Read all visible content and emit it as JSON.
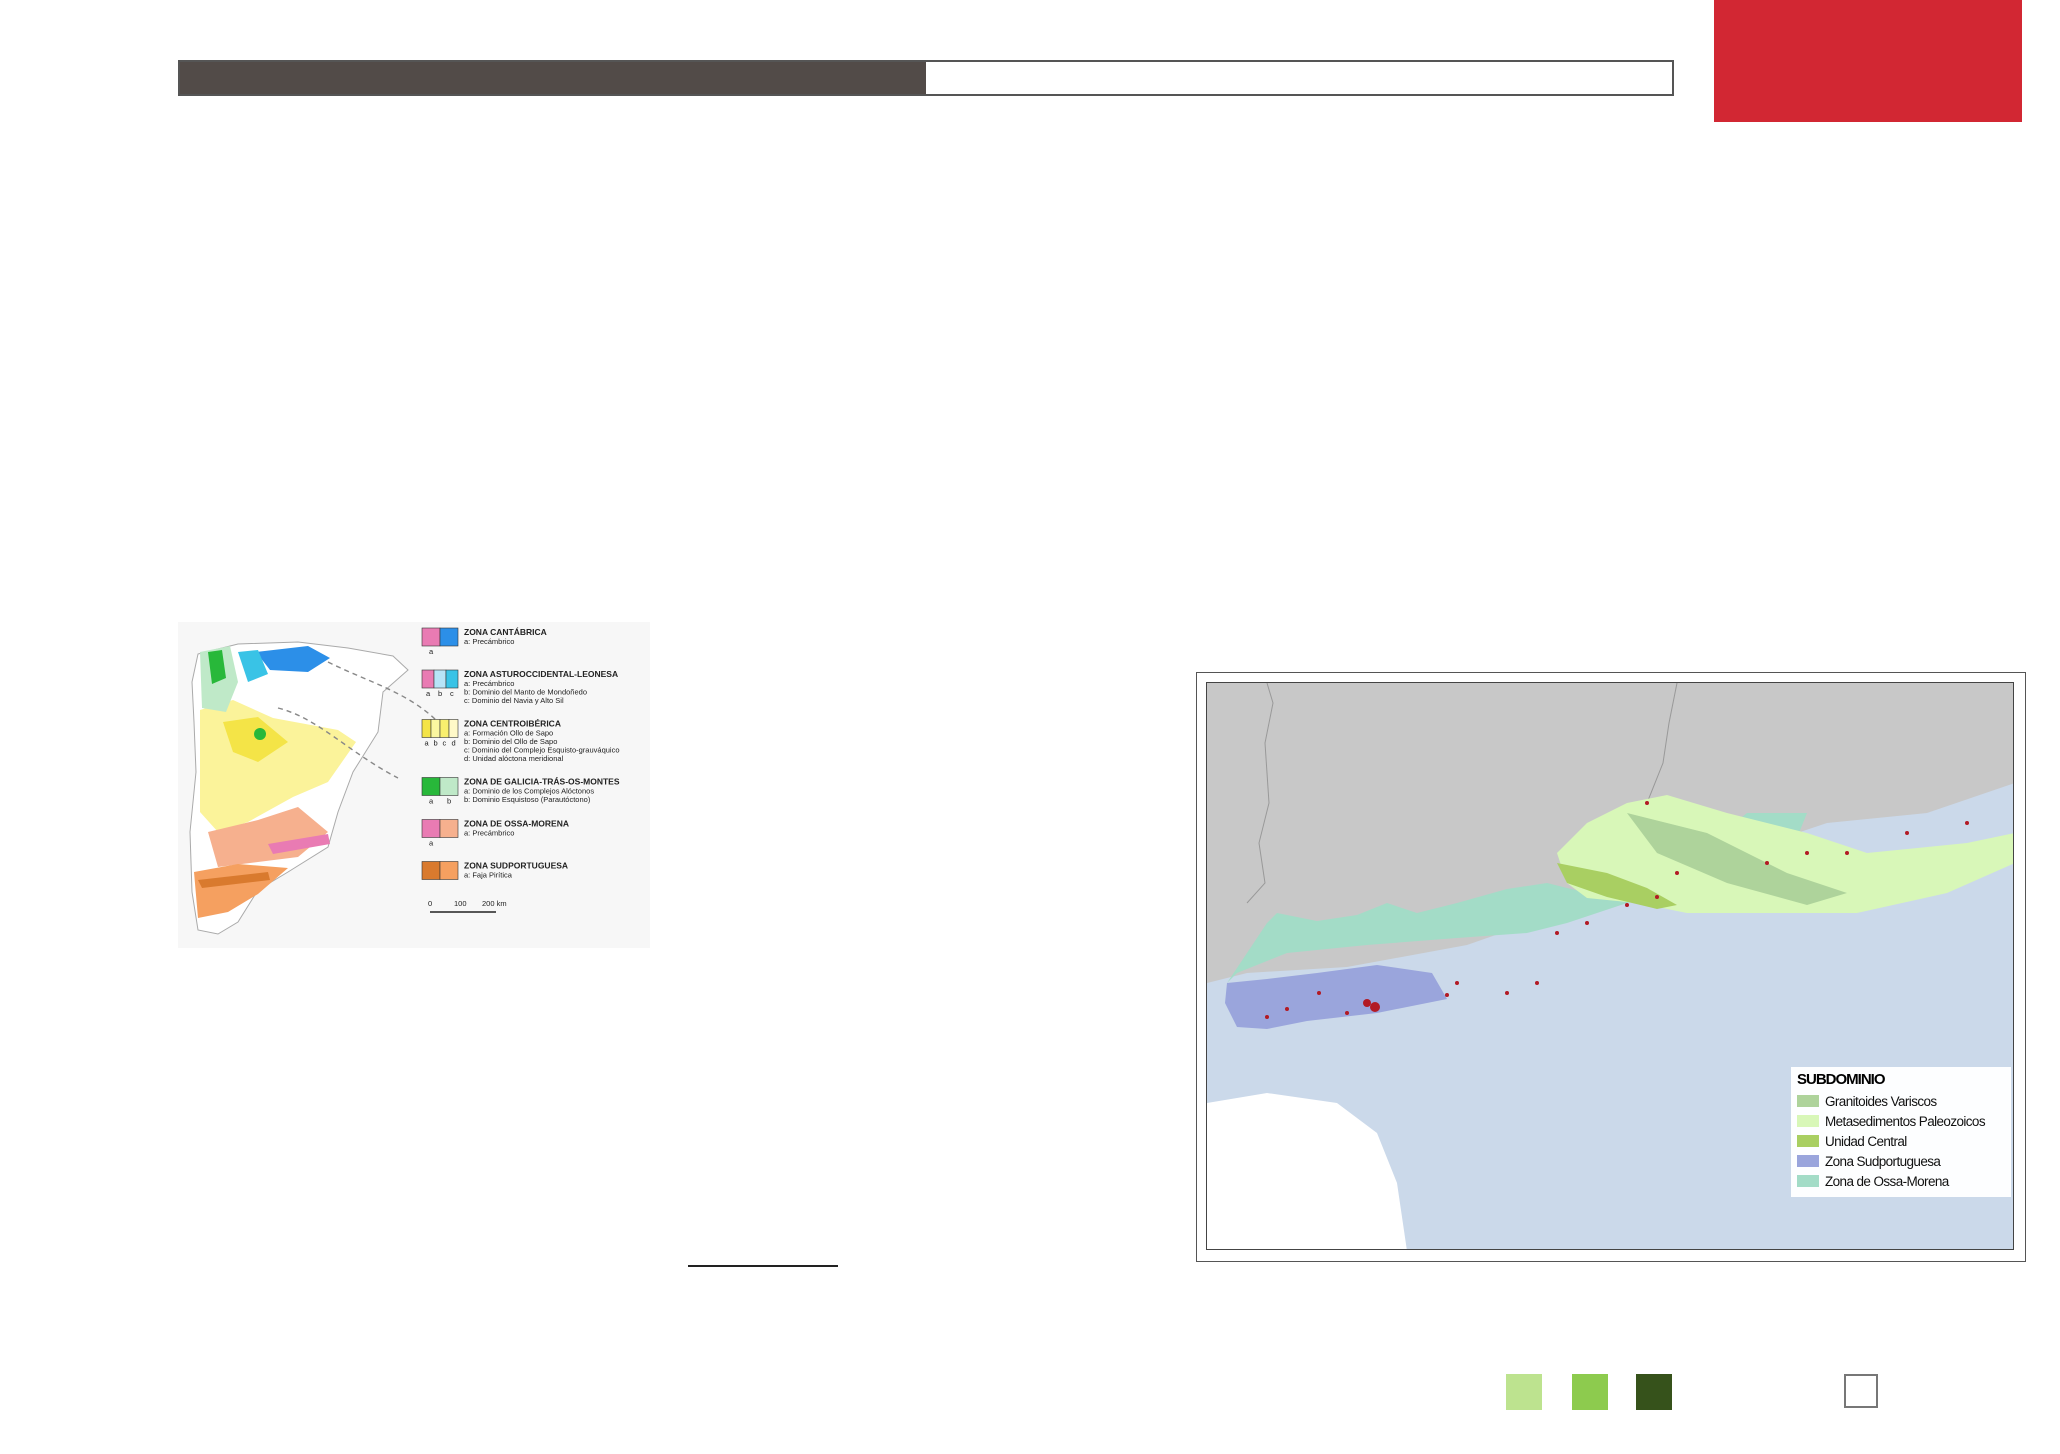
{
  "header": {
    "progress_fraction": 0.5,
    "bar_fill_color": "#524b48",
    "accent_color": "#d22733"
  },
  "left_map": {
    "legend": [
      {
        "title": "ZONA CANTÁBRICA",
        "items": [
          "a: Precámbrico"
        ],
        "swatches": [
          "#e97bb3",
          "#2c8fe8"
        ]
      },
      {
        "title": "ZONA ASTUROCCIDENTAL-LEONESA",
        "items": [
          "a: Precámbrico",
          "b: Dominio del Manto de Mondoñedo",
          "c: Dominio del Navia y Alto Sil"
        ],
        "swatches": [
          "#e97bb3",
          "#b7e4f7",
          "#39c3e6"
        ]
      },
      {
        "title": "ZONA CENTROIBÉRICA",
        "items": [
          "a: Formación Ollo de Sapo",
          "b: Dominio del Ollo de Sapo",
          "c: Dominio del Complejo Esquisto-grauváquico",
          "d: Unidad alóctona meridional"
        ],
        "swatches": [
          "#f4e447",
          "#fbf7a0",
          "#f8ef6e",
          "#fff9c8"
        ]
      },
      {
        "title": "ZONA DE GALICIA-TRÁS-OS-MONTES",
        "items": [
          "a: Dominio de los Complejos Alóctonos",
          "b: Dominio Esquistoso (Parautóctono)"
        ],
        "swatches": [
          "#28b83a",
          "#bfe9c8"
        ]
      },
      {
        "title": "ZONA DE OSSA-MORENA",
        "items": [
          "a: Precámbrico"
        ],
        "swatches": [
          "#e97bb3",
          "#f6b08e"
        ]
      },
      {
        "title": "ZONA SUDPORTUGUESA",
        "items": [
          "a: Faja Pirítica"
        ],
        "swatches": [
          "#d97a2e",
          "#f5a060"
        ]
      }
    ],
    "swatch_letters": [
      [
        "a"
      ],
      [
        "a",
        "b",
        "c"
      ],
      [
        "a",
        "b",
        "c",
        "d"
      ],
      [
        "a",
        "b"
      ],
      [
        "a"
      ],
      []
    ],
    "scale": {
      "ticks": [
        "0",
        "100",
        "200 km"
      ]
    }
  },
  "right_map": {
    "legend_title": "SUBDOMINIO",
    "legend": [
      {
        "label": "Granitoides Variscos",
        "color": "#aed39b"
      },
      {
        "label": "Metasedimentos Paleozoicos",
        "color": "#d8f7b8"
      },
      {
        "label": "Unidad Central",
        "color": "#a9cf62"
      },
      {
        "label": "Zona Sudportuguesa",
        "color": "#9aa5dc"
      },
      {
        "label": "Zona de Ossa-Morena",
        "color": "#a3dcc7"
      }
    ]
  },
  "footer": {
    "squares": [
      "#bde38f",
      "#8dcb4e",
      "#36521b"
    ]
  }
}
